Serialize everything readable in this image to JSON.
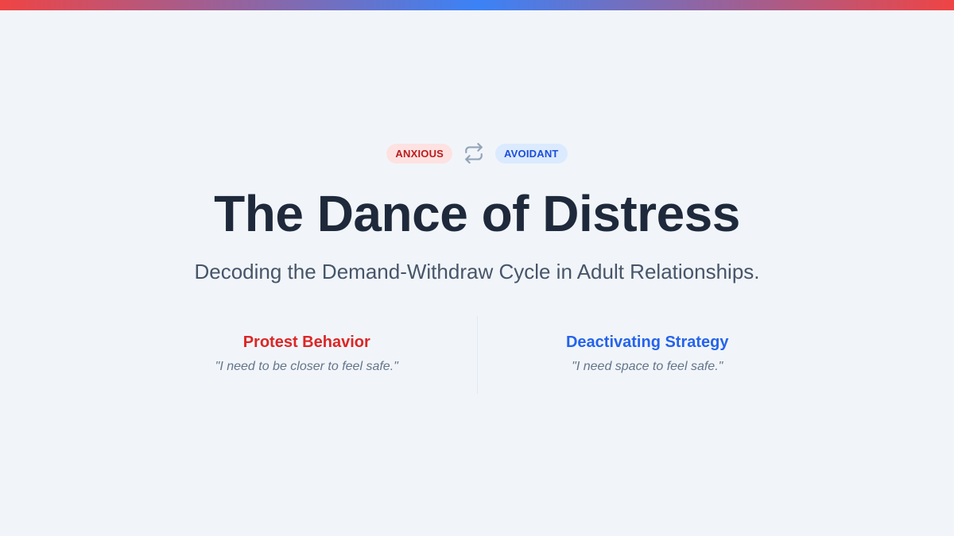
{
  "badges": {
    "left": "ANXIOUS",
    "right": "AVOIDANT"
  },
  "icon": "repeat-cycle-icon",
  "title": "The Dance of Distress",
  "subtitle": "Decoding the Demand-Withdraw Cycle in Adult Relationships.",
  "columns": [
    {
      "heading": "Protest Behavior",
      "quote": "\"I need to be closer to feel safe.\""
    },
    {
      "heading": "Deactivating Strategy",
      "quote": "\"I need space to feel safe.\""
    }
  ],
  "colors": {
    "anxious": "#dc2626",
    "avoidant": "#2563eb",
    "title": "#1e293b",
    "background": "#f1f5f9"
  }
}
